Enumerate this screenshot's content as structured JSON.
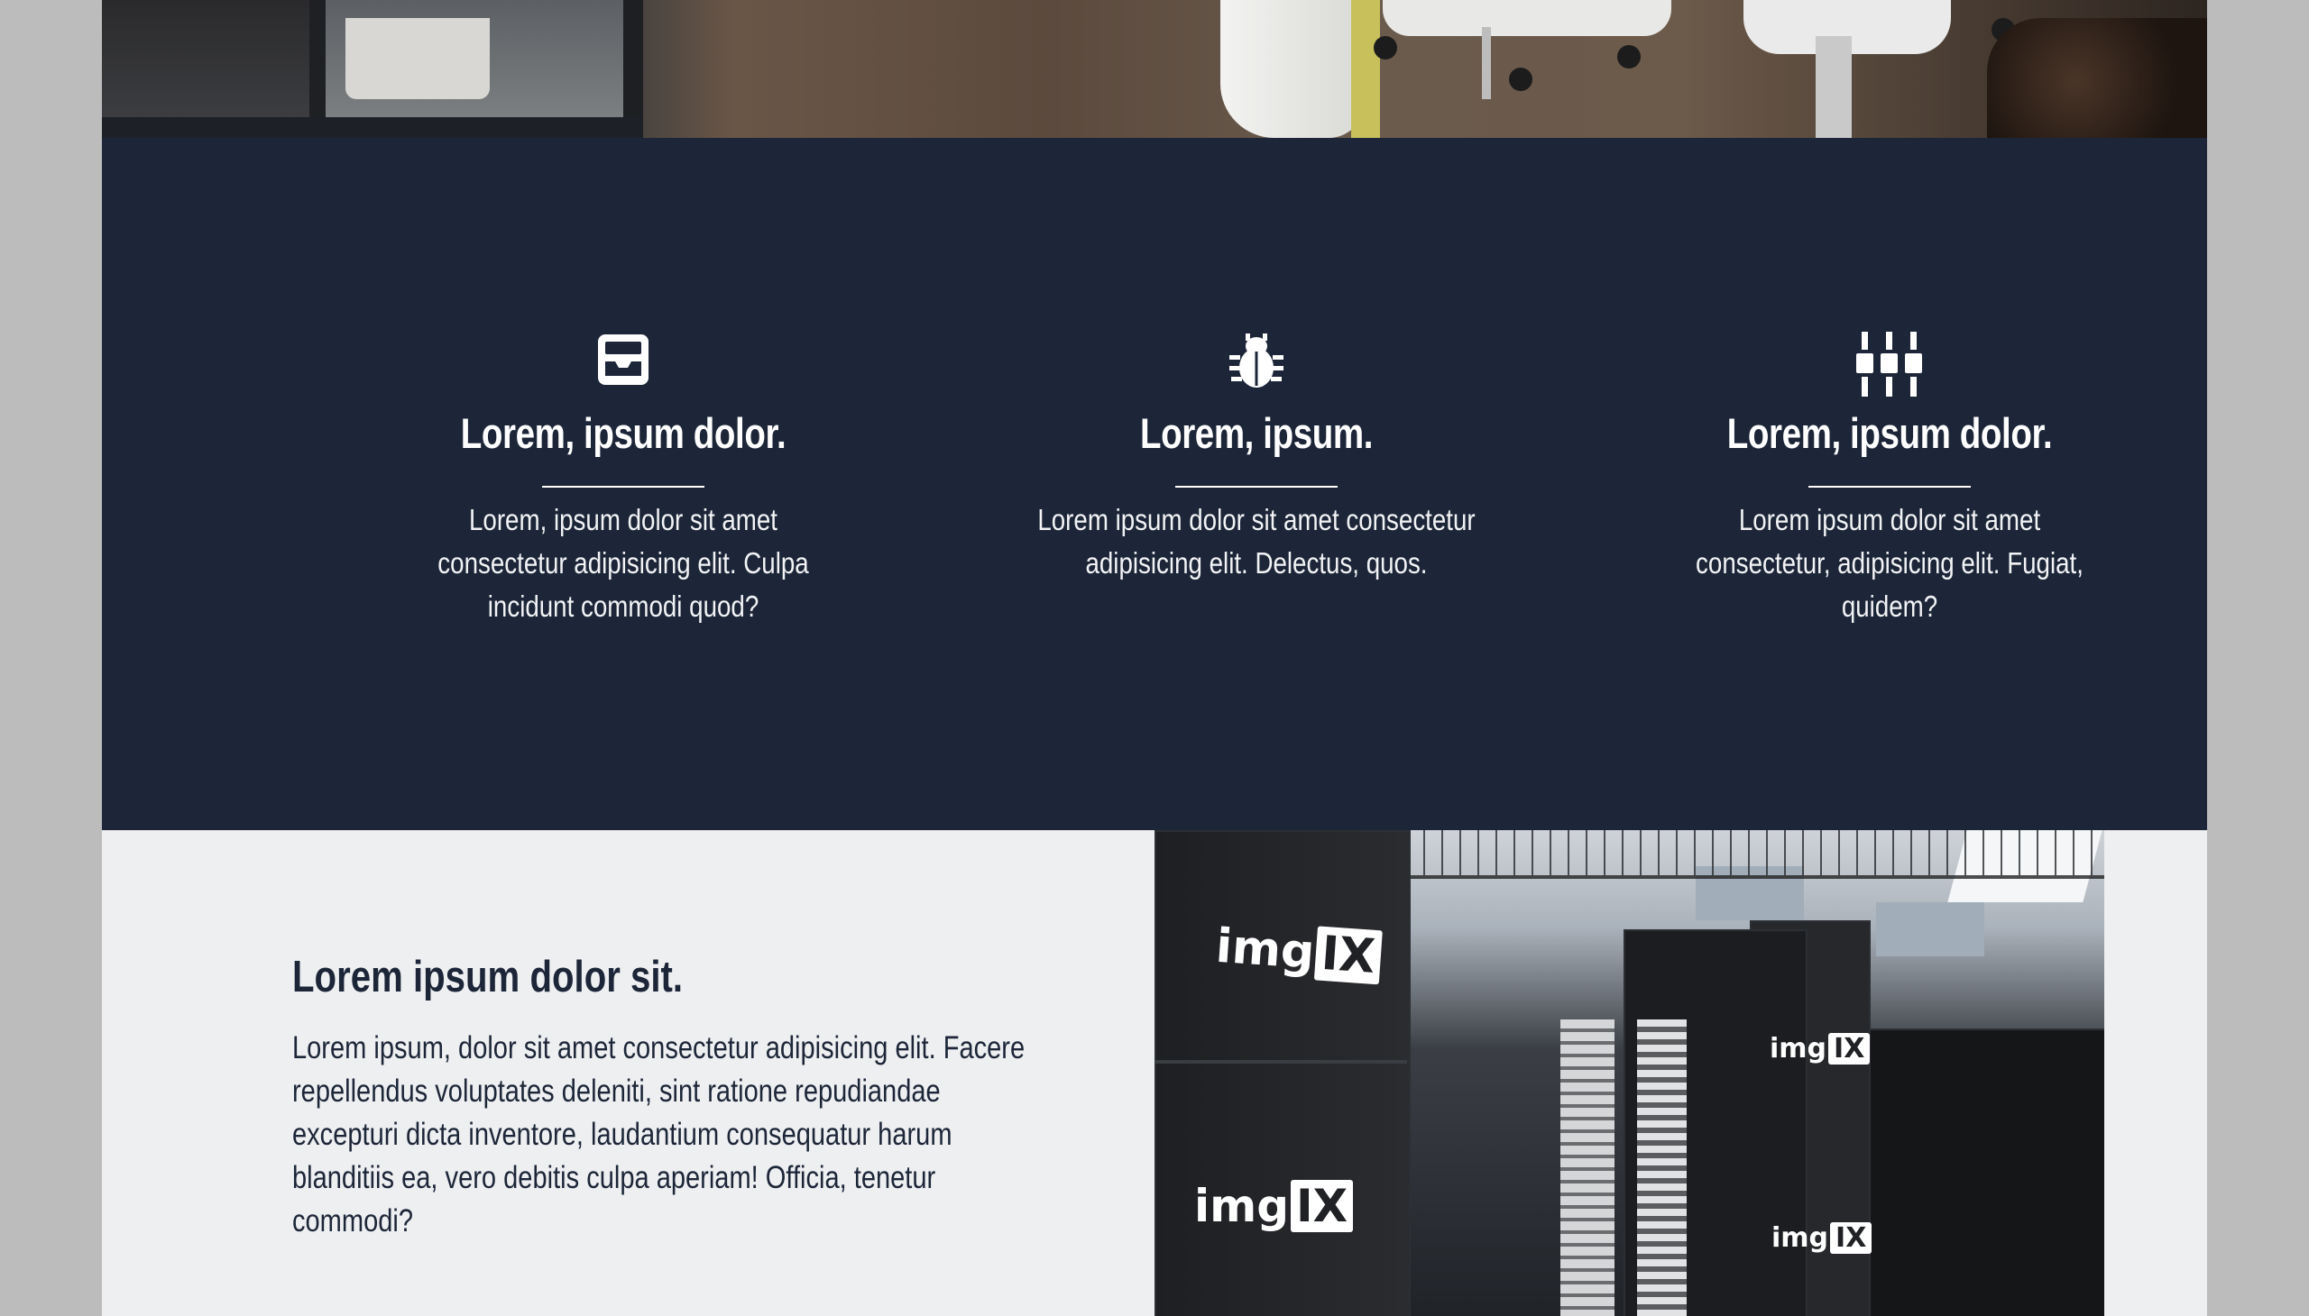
{
  "hero": {
    "image_label": "office photo banner"
  },
  "features": [
    {
      "icon": "inbox-tray-icon",
      "title": "Lorem, ipsum dolor.",
      "text": "Lorem, ipsum dolor sit amet consectetur adipisicing elit. Culpa incidunt commodi quod?"
    },
    {
      "icon": "bug-icon",
      "title": "Lorem, ipsum.",
      "text": "Lorem ipsum dolor sit amet consectetur adipisicing elit. Delectus, quos."
    },
    {
      "icon": "sliders-icon",
      "title": "Lorem, ipsum dolor.",
      "text": "Lorem ipsum dolor sit amet consectetur, adipisicing elit. Fugiat, quidem?"
    }
  ],
  "about": {
    "heading": "Lorem ipsum dolor sit.",
    "body": "Lorem ipsum, dolor sit amet consectetur adipisicing elit. Facere repellendus voluptates deleniti, sint ratione repudiandae excepturi dicta inventore, laudantium consequatur harum blanditiis ea, vero debitis culpa aperiam! Officia, tenetur commodi?"
  },
  "server_image": {
    "logo_text": "img",
    "logo_badge": "IX"
  },
  "colors": {
    "navy": "#1c2638",
    "light_bg": "#eeeff1",
    "outer_bg": "#bdbcbd"
  }
}
